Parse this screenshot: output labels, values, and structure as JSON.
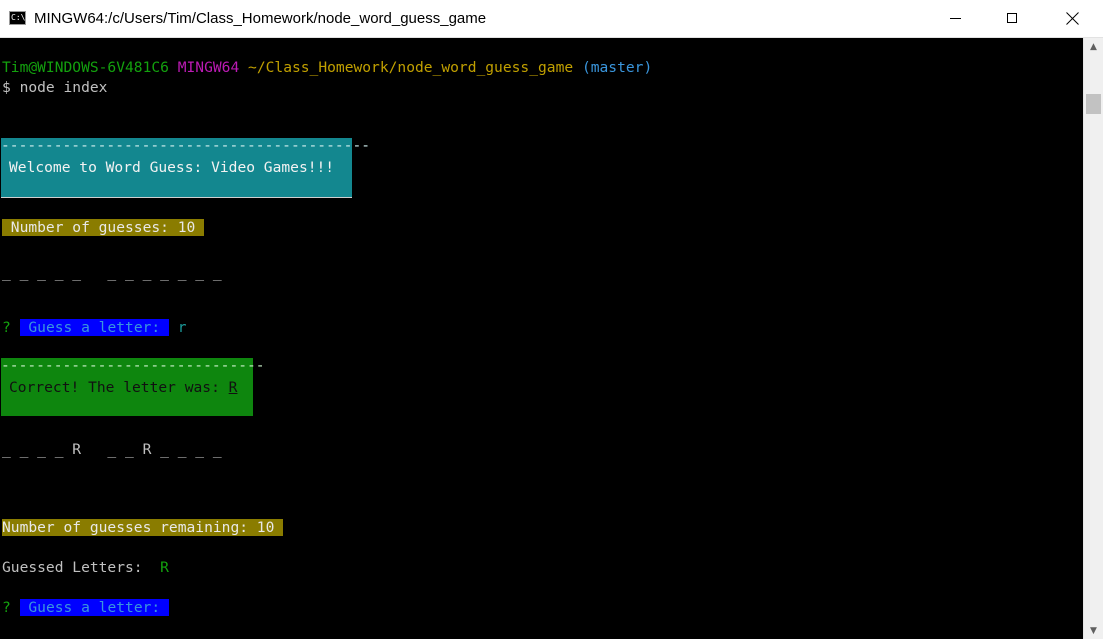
{
  "window": {
    "title": "MINGW64:/c/Users/Tim/Class_Homework/node_word_guess_game",
    "icon": "console-icon",
    "icon_glyph": "C:\\_"
  },
  "prompt": {
    "user_host": "Tim@WINDOWS-6V481C6",
    "shell": "MINGW64",
    "path": "~/Class_Homework/node_word_guess_game",
    "branch": "(master)",
    "command_line": "$ node index"
  },
  "game": {
    "welcome_border": "------------------------------------------",
    "welcome_text": "Welcome to Word Guess: Video Games!!!",
    "guesses_text": " Number of guesses: 10 ",
    "blanks_initial": "_ _ _ _ _   _ _ _ _ _ _ _",
    "question_mark_1": "?",
    "guess_prompt_1": " Guess a letter: ",
    "guess_answer_1": "r",
    "correct_border": "------------------------------",
    "correct_text": "Correct! The letter was: ",
    "correct_letter": "R",
    "blanks_after": "_ _ _ _ R   _ _ R _ _ _ _",
    "remaining_text": "Number of guesses remaining: 10 ",
    "guessed_label": "Guessed Letters:  ",
    "guessed_letters": "R",
    "question_mark_2": "?",
    "guess_prompt_2": " Guess a letter: "
  },
  "colors": {
    "terminal_bg": "#000000",
    "prompt_user": "#13a10e",
    "prompt_shell": "#bc1bb4",
    "prompt_path": "#c1a000",
    "prompt_branch": "#3a96dd",
    "welcome_bg": "#13878f",
    "correct_bg": "#0e860e",
    "guesses_bg": "#8a7c00",
    "prompt_bg": "#0000ff"
  }
}
